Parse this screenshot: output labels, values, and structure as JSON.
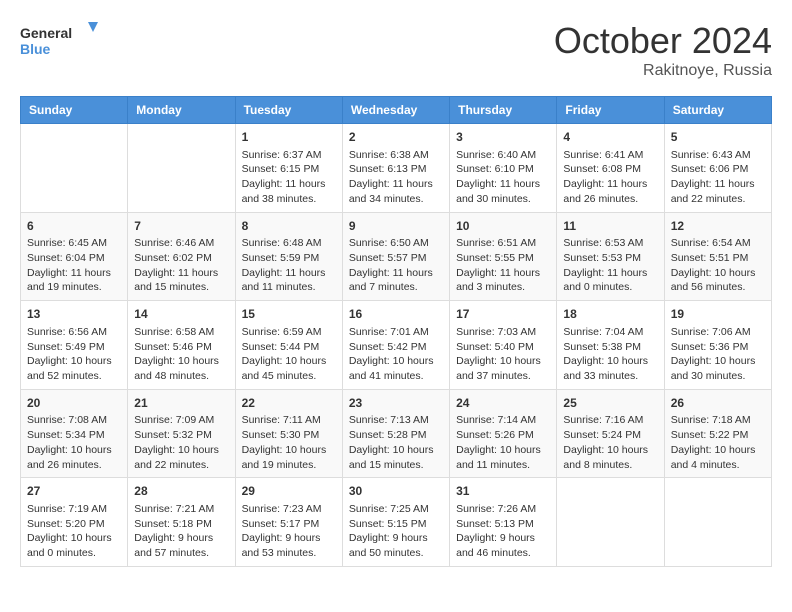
{
  "header": {
    "logo_line1": "General",
    "logo_line2": "Blue",
    "month_title": "October 2024",
    "location": "Rakitnoye, Russia"
  },
  "weekdays": [
    "Sunday",
    "Monday",
    "Tuesday",
    "Wednesday",
    "Thursday",
    "Friday",
    "Saturday"
  ],
  "weeks": [
    [
      {
        "day": "",
        "content": ""
      },
      {
        "day": "",
        "content": ""
      },
      {
        "day": "1",
        "content": "Sunrise: 6:37 AM\nSunset: 6:15 PM\nDaylight: 11 hours and 38 minutes."
      },
      {
        "day": "2",
        "content": "Sunrise: 6:38 AM\nSunset: 6:13 PM\nDaylight: 11 hours and 34 minutes."
      },
      {
        "day": "3",
        "content": "Sunrise: 6:40 AM\nSunset: 6:10 PM\nDaylight: 11 hours and 30 minutes."
      },
      {
        "day": "4",
        "content": "Sunrise: 6:41 AM\nSunset: 6:08 PM\nDaylight: 11 hours and 26 minutes."
      },
      {
        "day": "5",
        "content": "Sunrise: 6:43 AM\nSunset: 6:06 PM\nDaylight: 11 hours and 22 minutes."
      }
    ],
    [
      {
        "day": "6",
        "content": "Sunrise: 6:45 AM\nSunset: 6:04 PM\nDaylight: 11 hours and 19 minutes."
      },
      {
        "day": "7",
        "content": "Sunrise: 6:46 AM\nSunset: 6:02 PM\nDaylight: 11 hours and 15 minutes."
      },
      {
        "day": "8",
        "content": "Sunrise: 6:48 AM\nSunset: 5:59 PM\nDaylight: 11 hours and 11 minutes."
      },
      {
        "day": "9",
        "content": "Sunrise: 6:50 AM\nSunset: 5:57 PM\nDaylight: 11 hours and 7 minutes."
      },
      {
        "day": "10",
        "content": "Sunrise: 6:51 AM\nSunset: 5:55 PM\nDaylight: 11 hours and 3 minutes."
      },
      {
        "day": "11",
        "content": "Sunrise: 6:53 AM\nSunset: 5:53 PM\nDaylight: 11 hours and 0 minutes."
      },
      {
        "day": "12",
        "content": "Sunrise: 6:54 AM\nSunset: 5:51 PM\nDaylight: 10 hours and 56 minutes."
      }
    ],
    [
      {
        "day": "13",
        "content": "Sunrise: 6:56 AM\nSunset: 5:49 PM\nDaylight: 10 hours and 52 minutes."
      },
      {
        "day": "14",
        "content": "Sunrise: 6:58 AM\nSunset: 5:46 PM\nDaylight: 10 hours and 48 minutes."
      },
      {
        "day": "15",
        "content": "Sunrise: 6:59 AM\nSunset: 5:44 PM\nDaylight: 10 hours and 45 minutes."
      },
      {
        "day": "16",
        "content": "Sunrise: 7:01 AM\nSunset: 5:42 PM\nDaylight: 10 hours and 41 minutes."
      },
      {
        "day": "17",
        "content": "Sunrise: 7:03 AM\nSunset: 5:40 PM\nDaylight: 10 hours and 37 minutes."
      },
      {
        "day": "18",
        "content": "Sunrise: 7:04 AM\nSunset: 5:38 PM\nDaylight: 10 hours and 33 minutes."
      },
      {
        "day": "19",
        "content": "Sunrise: 7:06 AM\nSunset: 5:36 PM\nDaylight: 10 hours and 30 minutes."
      }
    ],
    [
      {
        "day": "20",
        "content": "Sunrise: 7:08 AM\nSunset: 5:34 PM\nDaylight: 10 hours and 26 minutes."
      },
      {
        "day": "21",
        "content": "Sunrise: 7:09 AM\nSunset: 5:32 PM\nDaylight: 10 hours and 22 minutes."
      },
      {
        "day": "22",
        "content": "Sunrise: 7:11 AM\nSunset: 5:30 PM\nDaylight: 10 hours and 19 minutes."
      },
      {
        "day": "23",
        "content": "Sunrise: 7:13 AM\nSunset: 5:28 PM\nDaylight: 10 hours and 15 minutes."
      },
      {
        "day": "24",
        "content": "Sunrise: 7:14 AM\nSunset: 5:26 PM\nDaylight: 10 hours and 11 minutes."
      },
      {
        "day": "25",
        "content": "Sunrise: 7:16 AM\nSunset: 5:24 PM\nDaylight: 10 hours and 8 minutes."
      },
      {
        "day": "26",
        "content": "Sunrise: 7:18 AM\nSunset: 5:22 PM\nDaylight: 10 hours and 4 minutes."
      }
    ],
    [
      {
        "day": "27",
        "content": "Sunrise: 7:19 AM\nSunset: 5:20 PM\nDaylight: 10 hours and 0 minutes."
      },
      {
        "day": "28",
        "content": "Sunrise: 7:21 AM\nSunset: 5:18 PM\nDaylight: 9 hours and 57 minutes."
      },
      {
        "day": "29",
        "content": "Sunrise: 7:23 AM\nSunset: 5:17 PM\nDaylight: 9 hours and 53 minutes."
      },
      {
        "day": "30",
        "content": "Sunrise: 7:25 AM\nSunset: 5:15 PM\nDaylight: 9 hours and 50 minutes."
      },
      {
        "day": "31",
        "content": "Sunrise: 7:26 AM\nSunset: 5:13 PM\nDaylight: 9 hours and 46 minutes."
      },
      {
        "day": "",
        "content": ""
      },
      {
        "day": "",
        "content": ""
      }
    ]
  ]
}
